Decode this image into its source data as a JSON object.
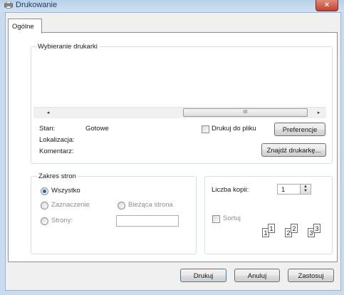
{
  "window": {
    "title": "Drukowanie",
    "close_glyph": "×"
  },
  "tabs": [
    {
      "label": "Ogólne"
    }
  ],
  "printer_group": {
    "legend": "Wybieranie drukarki",
    "scrollbar_grip": "III",
    "left_arrow": "◂",
    "right_arrow": "▸",
    "status_label": "Stan:",
    "status_value": "Gotowe",
    "location_label": "Lokalizacja:",
    "comment_label": "Komentarz:",
    "print_to_file_label": "Drukuj do pliku",
    "preferences_button": "Preferencje",
    "find_printer_button": "Znajdź drukarkę..."
  },
  "range_group": {
    "legend": "Zakres stron",
    "all_label": "Wszystko",
    "selection_label": "Zaznaczenie",
    "current_page_label": "Bieżąca strona",
    "pages_label": "Strony:",
    "pages_value": ""
  },
  "copies_group": {
    "copies_label": "Liczba kopii:",
    "copies_value": "1",
    "collate_label": "Sortuj",
    "collate_pages": [
      "1",
      "1",
      "2",
      "2",
      "3",
      "3"
    ]
  },
  "footer": {
    "print_button": "Drukuj",
    "cancel_button": "Anuluj",
    "apply_button": "Zastosuj"
  },
  "colors": {
    "title_bar": "#c9dcef",
    "close_button": "#c5412b",
    "radio_selected": "#2b62b8"
  }
}
